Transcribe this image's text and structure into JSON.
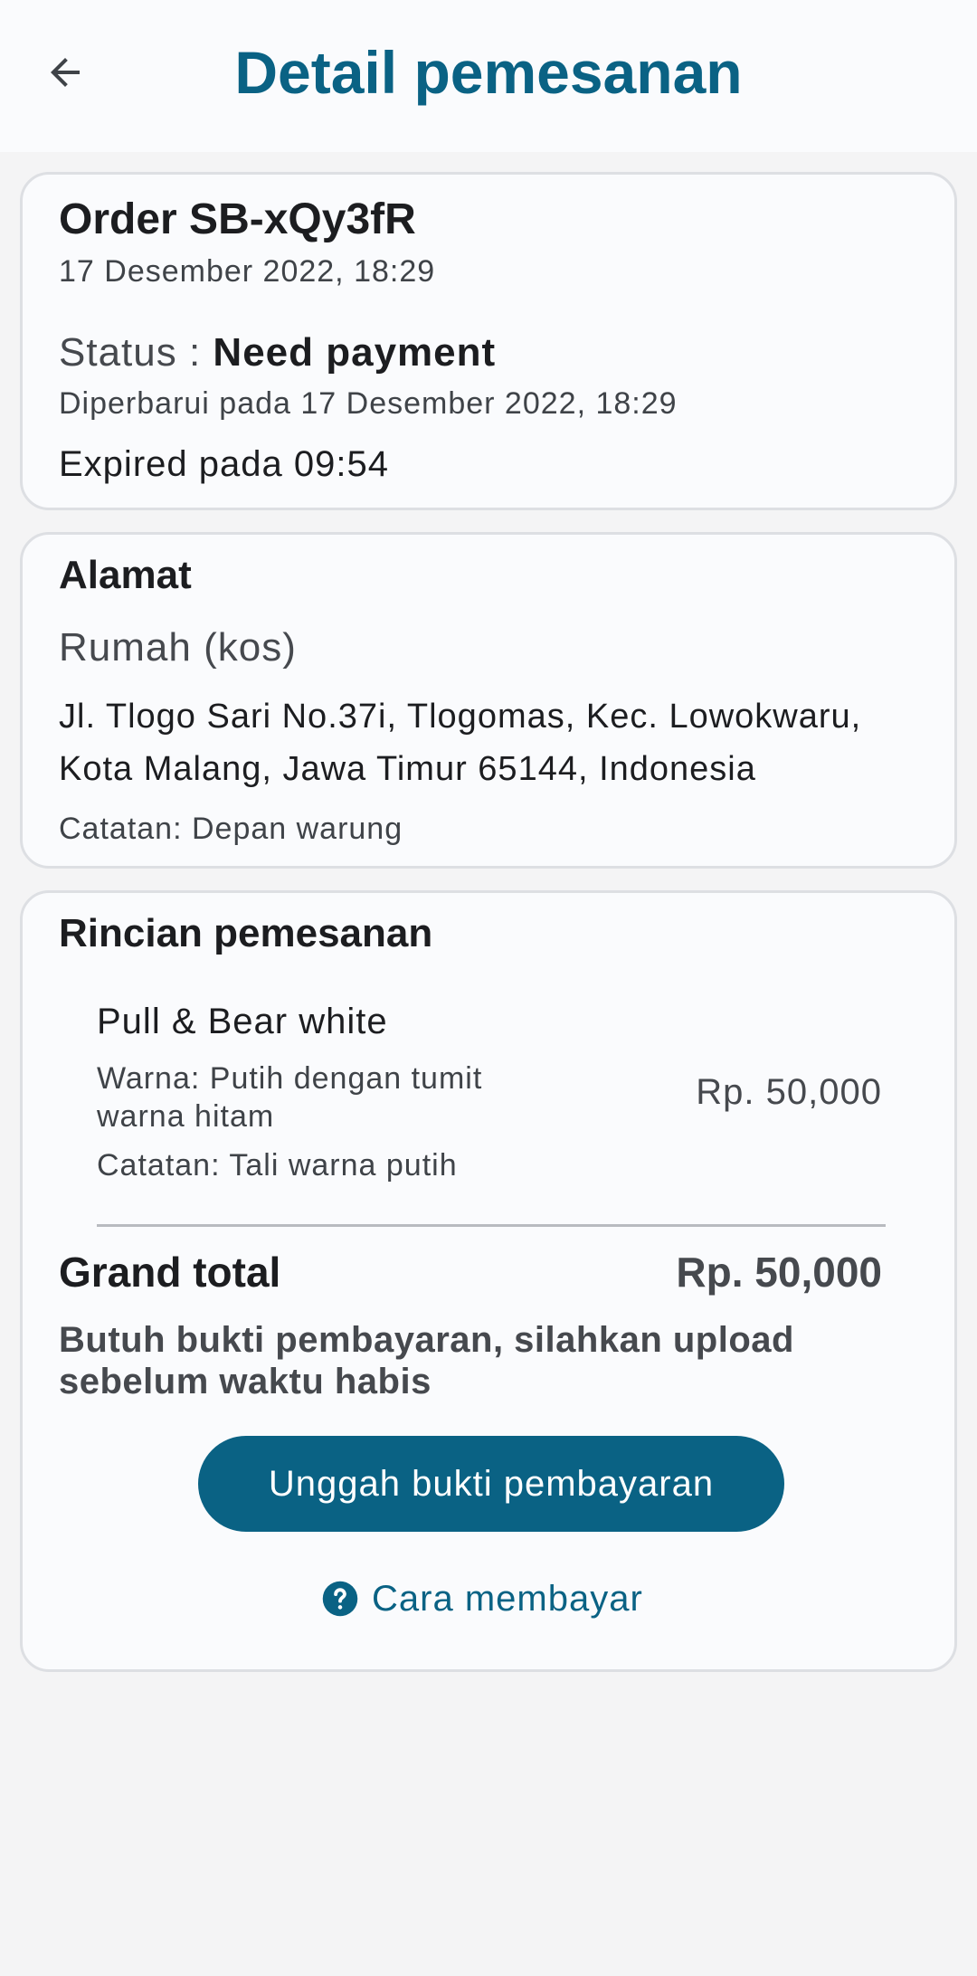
{
  "header": {
    "title": "Detail pemesanan"
  },
  "order": {
    "title": "Order SB-xQy3fR",
    "date": "17 Desember 2022, 18:29",
    "status_label": "Status : ",
    "status_value": "Need payment",
    "updated": "Diperbarui pada 17 Desember 2022, 18:29",
    "expired": "Expired pada 09:54"
  },
  "address": {
    "heading": "Alamat",
    "name": "Rumah (kos)",
    "line1": "Jl. Tlogo Sari No.37i, Tlogomas, Kec. Lowokwaru,",
    "line2": "Kota Malang, Jawa Timur 65144, Indonesia",
    "note": "Catatan: Depan warung"
  },
  "details": {
    "heading": "Rincian pemesanan",
    "item": {
      "name": "Pull & Bear white",
      "color_line1": "Warna: Putih dengan tumit",
      "color_line2": "warna hitam",
      "note": "Catatan: Tali warna putih",
      "price": "Rp. 50,000"
    },
    "grand_total_label": "Grand total",
    "grand_total_value": "Rp. 50,000",
    "payment_note_line1": "Butuh bukti pembayaran, silahkan upload",
    "payment_note_line2": "sebelum waktu habis",
    "upload_button": "Unggah bukti pembayaran",
    "help_link": "Cara membayar"
  },
  "icons": {
    "back": "arrow-left-icon",
    "help": "question-circle-icon"
  },
  "colors": {
    "accent": "#0a6284",
    "background": "#f4f4f5",
    "card": "#fafbfd"
  }
}
